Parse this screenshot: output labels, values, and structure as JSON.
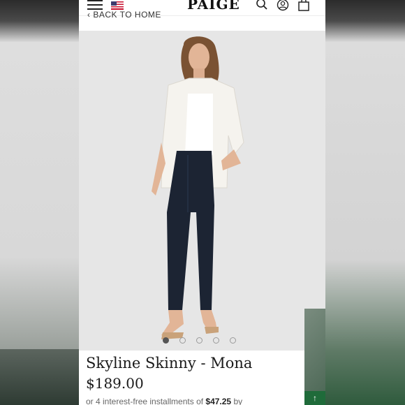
{
  "header": {
    "logo": "PAIGE",
    "back_link": "‹ BACK TO HOME"
  },
  "icons": {
    "menu": "menu-icon",
    "flag": "us-flag-icon",
    "search": "search-icon",
    "account": "account-icon",
    "cart": "shopping-bag-icon"
  },
  "product": {
    "title": "Skyline Skinny - Mona",
    "price": "$189.00",
    "installments_prefix": "or 4 interest-free installments of ",
    "installment_amount": "$47.25",
    "installments_suffix": " by"
  },
  "carousel": {
    "total": 5,
    "active_index": 0
  },
  "colors": {
    "background_page": "#ffffff",
    "image_bg": "#e6e6e6",
    "text_primary": "#1a1a1a",
    "widget_green": "#1f6b3a"
  }
}
